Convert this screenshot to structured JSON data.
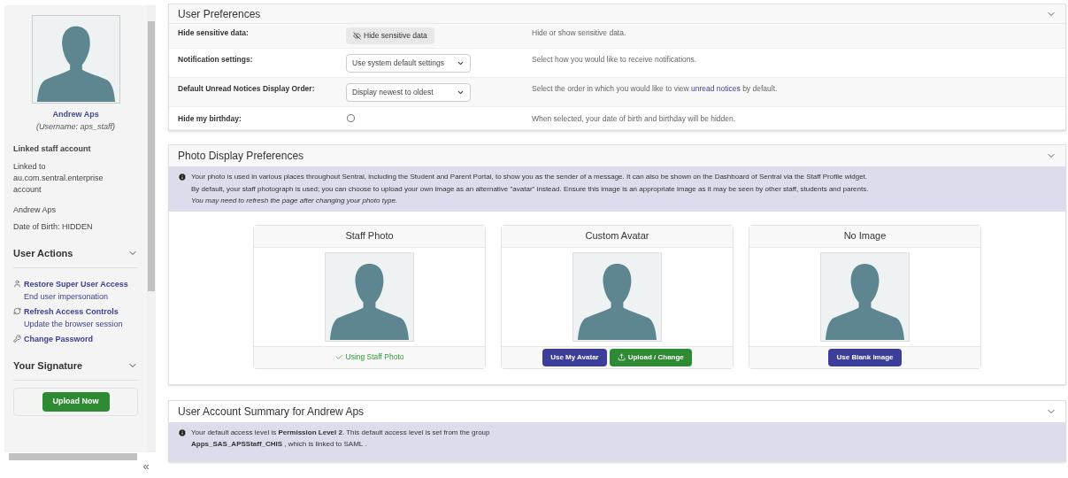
{
  "sidebar": {
    "name": "Andrew Aps",
    "username": "(Username: aps_staff)",
    "linked_title": "Linked staff account",
    "linked_text": "Linked to au.com.sentral.enterprise account",
    "display_name": "Andrew Aps",
    "dob": "Date of Birth: HIDDEN",
    "sections": [
      {
        "title": "User Actions",
        "expanded": true,
        "actions": [
          {
            "kind": "user",
            "label": "Restore Super User Access",
            "hint": "End user impersonation"
          },
          {
            "kind": "refresh",
            "label": "Refresh Access Controls",
            "hint": "Update the browser session"
          },
          {
            "kind": "key",
            "label": "Change Password"
          }
        ]
      },
      {
        "title": "Your Signature",
        "expanded": true,
        "button": "Upload Now"
      }
    ],
    "collapse": "«"
  },
  "preferences": {
    "title": "User Preferences",
    "rows": [
      {
        "label": "Hide sensitive data:",
        "kind": "button",
        "value": "Hide sensitive data",
        "description": "Hide or show sensitive data."
      },
      {
        "label": "Notification settings:",
        "kind": "select",
        "value": "Use system default settings",
        "description": "Select how you would like to receive notifications."
      },
      {
        "label": "Default Unread Notices Display Order:",
        "kind": "select",
        "value": "Display newest to oldest",
        "description": "Select the order in which you would like to view ",
        "link": "unread notices",
        "description_after": " by default."
      },
      {
        "label": "Hide my birthday:",
        "kind": "checkbox",
        "checked": false,
        "description": "When selected, your date of birth and birthday will be hidden."
      }
    ]
  },
  "photo": {
    "title": "Photo Display Preferences",
    "info": [
      "Your photo is used in various places throughout Sentral, including the Student and Parent Portal, to show you as the sender of a message. It can also be shown on the Dashboard of Sentral via the Staff Profile widget.",
      "By default, your staff photograph is used; you can choose to upload your own image as an alternative \"avatar\" instead. Ensure this image is an appropriate image as it may be seen by other staff, students and parents."
    ],
    "note": "You may need to refresh the page after changing your photo type.",
    "options": [
      {
        "title": "Staff Photo",
        "status": "Using Staff Photo"
      },
      {
        "title": "Custom Avatar",
        "buttons": [
          {
            "kind": "primary",
            "label": "Use My Avatar"
          },
          {
            "kind": "upload",
            "label": "Upload / Change"
          }
        ]
      },
      {
        "title": "No Image",
        "buttons": [
          {
            "kind": "primary",
            "label": "Use Blank Image"
          }
        ]
      }
    ]
  },
  "summary": {
    "title": "User Account Summary for Andrew Aps",
    "info": "Your default access level is **Permission Level 2**. This default access level is set from the group **Apps_SAS_APSStaff_CHIS** , which is linked to SAML ."
  }
}
